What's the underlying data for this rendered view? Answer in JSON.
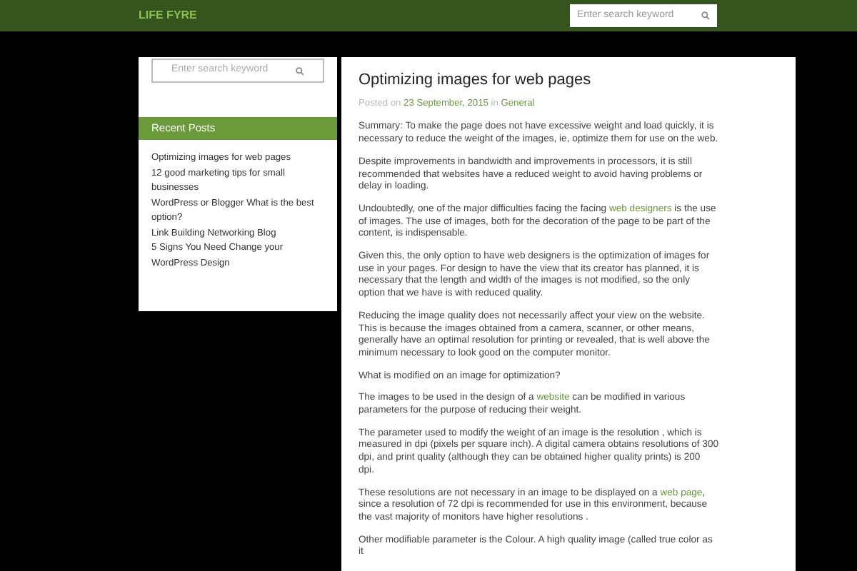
{
  "header": {
    "logo": "LIFE FYRE",
    "search": {
      "placeholder": "Enter search keyword"
    }
  },
  "sidebar": {
    "search": {
      "placeholder": "Enter search keyword"
    },
    "widget_title": "Recent Posts",
    "posts": [
      "Optimizing images for web pages",
      "12 good marketing tips for small businesses",
      "WordPress or Blogger What is the best option?",
      "Link Building Networking Blog",
      "5 Signs You Need Change your WordPress Design"
    ]
  },
  "article": {
    "title": "Optimizing images for web pages",
    "meta": [
      {
        "kind": "text",
        "text": "Posted on"
      },
      {
        "kind": "link",
        "text": "23 September, 2015"
      },
      {
        "kind": "text",
        "text": "in"
      },
      {
        "kind": "link",
        "text": "General"
      }
    ],
    "paragraphs": [
      [
        {
          "kind": "text",
          "text": "Summary: To make the page does not have excessive weight and load quickly, it is necessary to reduce the weight of the images, ie, optimize them for use on the web."
        }
      ],
      [
        {
          "kind": "text",
          "text": "Despite improvements in bandwidth and improvements in processors, it is still recommended that websites have a reduced weight to avoid having problems or delay in loading."
        }
      ],
      [
        {
          "kind": "text",
          "text": "Undoubtedly, one of the major difficulties facing the facing"
        },
        {
          "kind": "link",
          "text": "web designers"
        },
        {
          "kind": "text",
          "text": "is the use of images. The use of images, both for the decoration of the page to be part of the content, is indispensable."
        }
      ],
      [
        {
          "kind": "text",
          "text": "Given this, the only option to have web designers is the optimization of images for use in your pages. For design to have the view that its creator has planned, it is necessary that the length and width of the images is not modified, so the only option that we have is with reduced quality."
        }
      ],
      [
        {
          "kind": "text",
          "text": "Reducing the image quality does not necessarily affect your view on the website. This is because the images obtained from a camera, scanner, or other means, generally have an optimal resolution for printing or revealed, that is well above the minimum necessary to look good on the computer monitor."
        }
      ],
      [
        {
          "kind": "text",
          "text": "What is modified on an image for optimization?"
        }
      ],
      [
        {
          "kind": "text",
          "text": "The images to be used in the design of a"
        },
        {
          "kind": "link",
          "text": "website"
        },
        {
          "kind": "text",
          "text": "can be modified in various parameters for the purpose of reducing their weight."
        }
      ],
      [
        {
          "kind": "text",
          "text": "The parameter used to modify the weight of an image is the resolution , which is measured in dpi (pixels per square inch). A digital camera obtains resolutions of 300 dpi, and print quality (although they can be obtained higher quality prints) is 200 dpi."
        }
      ],
      [
        {
          "kind": "text",
          "text": "These resolutions are not necessary in an image to be displayed on a"
        },
        {
          "kind": "link",
          "text": "web page"
        },
        {
          "kind": "text",
          "text": ", since a resolution of 72 dpi is recommended for use in this environment, because the vast majority of monitors have higher resolutions ."
        }
      ],
      [
        {
          "kind": "text",
          "text": "Other modifiable parameter is the Colour. A high quality image (called true color as it"
        }
      ]
    ]
  }
}
